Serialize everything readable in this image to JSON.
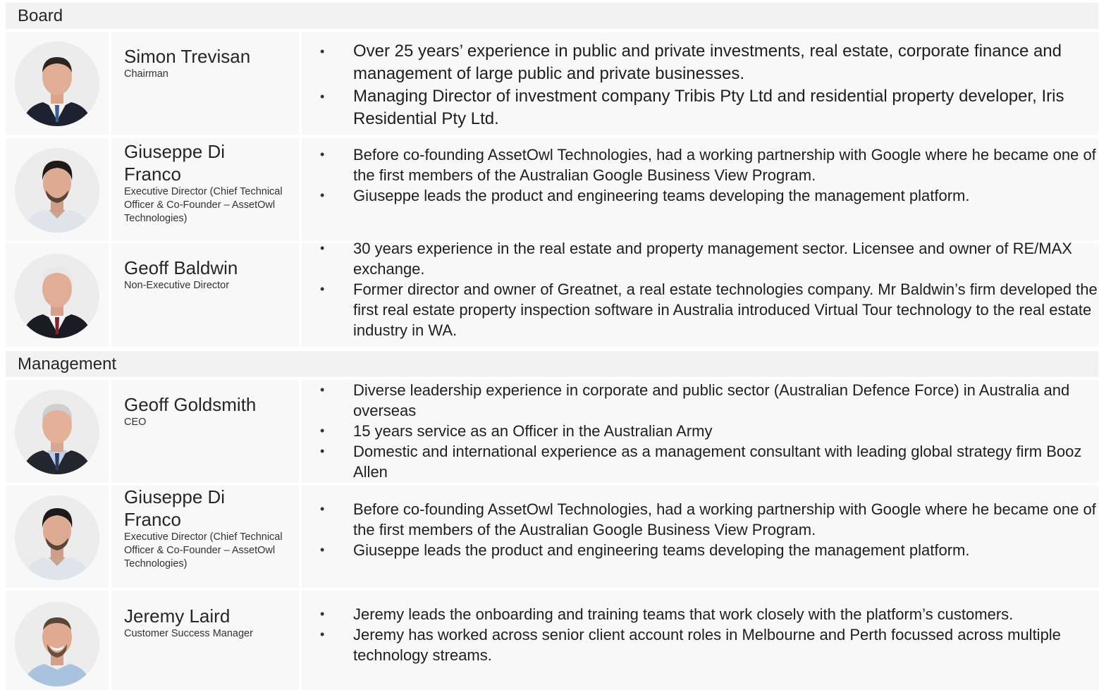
{
  "sections": [
    {
      "title": "Board",
      "people": [
        {
          "name": "Simon Trevisan",
          "role": "Chairman",
          "bullets": [
            "Over 25 years’ experience in public and private investments, real estate, corporate finance and management of large public and private businesses.",
            "Managing Director of investment company Tribis Pty Ltd and residential property developer, Iris Residential Pty Ltd."
          ]
        },
        {
          "name": "Giuseppe Di Franco",
          "role": "Executive Director (Chief Technical Officer & Co-Founder – AssetOwl Technologies)",
          "bullets": [
            "Before co-founding AssetOwl Technologies, had a working partnership with Google where he became one of the first members of the Australian Google Business View Program.",
            "Giuseppe leads the product and engineering teams developing the management platform."
          ]
        },
        {
          "name": "Geoff Baldwin",
          "role": "Non-Executive Director",
          "bullets": [
            "30 years experience in the real estate and property management sector. Licensee and owner of RE/MAX exchange.",
            "Former director and owner of Greatnet, a real estate technologies company. Mr Baldwin’s firm developed the first  real estate property inspection software in Australia introduced Virtual Tour technology to the real estate industry in  WA."
          ]
        }
      ]
    },
    {
      "title": "Management",
      "people": [
        {
          "name": "Geoff Goldsmith",
          "role": "CEO",
          "bullets": [
            "Diverse leadership experience in corporate and public sector (Australian Defence Force) in Australia and overseas",
            "15 years service as an Officer in the Australian Army",
            "Domestic and international experience as a management consultant with leading global strategy firm Booz Allen"
          ]
        },
        {
          "name": "Giuseppe Di Franco",
          "role": "Executive Director (Chief Technical Officer & Co-Founder – AssetOwl Technologies)",
          "bullets": [
            "Before co-founding AssetOwl Technologies, had a working partnership with Google where he became one of the first members of the Australian Google Business View Program.",
            "Giuseppe leads the product and engineering teams developing the management platform."
          ]
        },
        {
          "name": "Jeremy Laird",
          "role": "Customer Success Manager",
          "bullets": [
            "Jeremy leads the onboarding and training teams that work closely with the platform’s customers.",
            "Jeremy has worked across senior client account roles in Melbourne and Perth focussed across multiple technology streams."
          ]
        }
      ]
    }
  ]
}
